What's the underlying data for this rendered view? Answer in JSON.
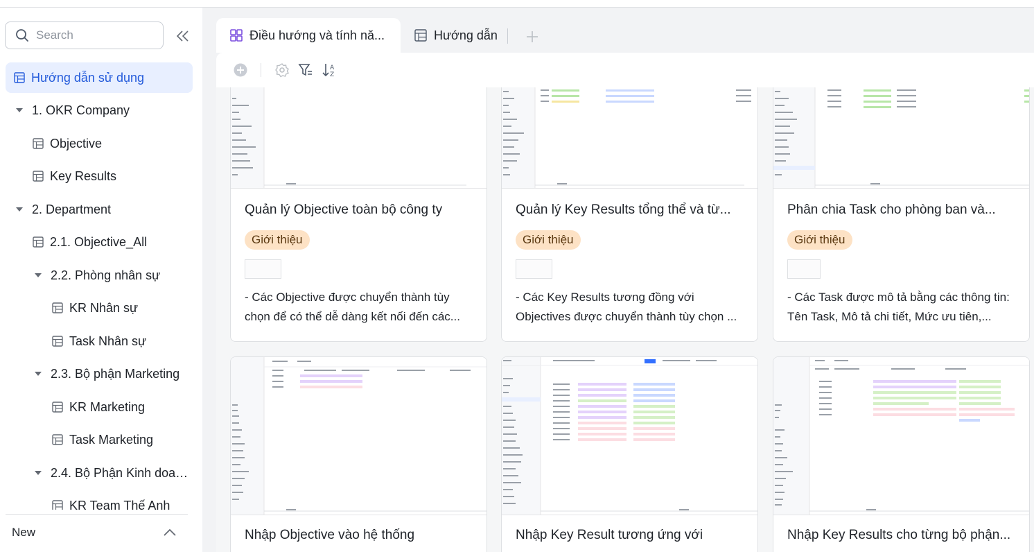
{
  "sidebar": {
    "search_placeholder": "Search",
    "items": [
      {
        "label": "Hướng dẫn sử dụng",
        "icon": "table-icon",
        "active": true
      },
      {
        "label": "1. OKR Company",
        "icon": "caret-down-icon"
      },
      {
        "label": "Objective",
        "icon": "table-icon"
      },
      {
        "label": "Key Results",
        "icon": "table-icon"
      },
      {
        "label": "2. Department",
        "icon": "caret-down-icon"
      },
      {
        "label": "2.1. Objective_All",
        "icon": "table-icon"
      },
      {
        "label": "2.2. Phòng nhân sự",
        "icon": "caret-down-icon"
      },
      {
        "label": "KR Nhân sự",
        "icon": "table-icon"
      },
      {
        "label": "Task Nhân sự",
        "icon": "table-icon"
      },
      {
        "label": "2.3. Bộ phận Marketing",
        "icon": "caret-down-icon"
      },
      {
        "label": "KR Marketing",
        "icon": "table-icon"
      },
      {
        "label": "Task Marketing",
        "icon": "table-icon"
      },
      {
        "label": "2.4. Bộ Phận Kinh doan...",
        "icon": "caret-down-icon"
      },
      {
        "label": "KR Team Thế Anh",
        "icon": "table-icon"
      }
    ],
    "new_label": "New"
  },
  "tabs": [
    {
      "label": "Điều hướng và tính nă...",
      "icon": "gallery-icon",
      "active": true
    },
    {
      "label": "Hướng dẫn",
      "icon": "table-icon",
      "active": false
    }
  ],
  "toolbar": {
    "icons": [
      "add-record-icon",
      "settings-icon",
      "filter-icon",
      "sort-icon"
    ]
  },
  "cards": [
    {
      "title": "Quản lý Objective toàn bộ công ty",
      "tag": "Giới thiệu",
      "desc": "- Các Objective được chuyển thành tùy chọn để có thể dễ dàng kết nối đến các..."
    },
    {
      "title": "Quản lý Key Results tổng thể và từ...",
      "tag": "Giới thiệu",
      "desc": "- Các Key Results tương đồng với Objectives được chuyển thành tùy chọn ..."
    },
    {
      "title": "Phân chia Task cho phòng ban và...",
      "tag": "Giới thiệu",
      "desc": "- Các Task được mô tả bằng các thông tin: Tên Task, Mô tả chi tiết, Mức ưu tiên,..."
    },
    {
      "title": "Nhập Objective vào hệ thống"
    },
    {
      "title": "Nhập Key Result tương ứng với"
    },
    {
      "title": "Nhập Key Results cho từng bộ phận..."
    }
  ],
  "colors": {
    "accent": "#245bdb",
    "active_bg": "#e8efff",
    "tag_bg": "#fde2c5",
    "border": "#dee0e3",
    "main_bg": "#f2f3f5"
  }
}
